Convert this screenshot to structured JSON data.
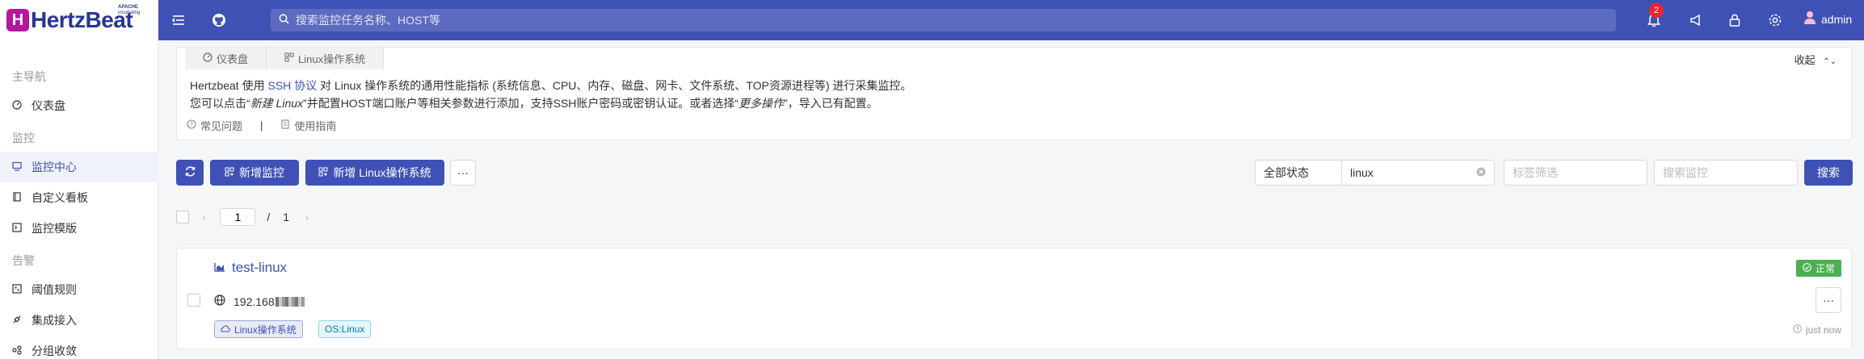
{
  "header": {
    "logo_text": "HertzBeat",
    "logo_sub1": "APACHE",
    "logo_sub2": "incubating",
    "search_placeholder": "搜索监控任务名称、HOST等",
    "notifications_count": "2",
    "user_name": "admin"
  },
  "sidebar": {
    "groups": [
      {
        "label": "主导航"
      },
      {
        "label": "监控"
      },
      {
        "label": "告警"
      }
    ],
    "items": [
      {
        "label": "仪表盘",
        "icon": "dashboard-icon"
      },
      {
        "label": "监控中心",
        "icon": "monitor-icon",
        "active": true
      },
      {
        "label": "自定义看板",
        "icon": "book-icon"
      },
      {
        "label": "监控模版",
        "icon": "code-icon"
      },
      {
        "label": "阈值规则",
        "icon": "rule-icon"
      },
      {
        "label": "集成接入",
        "icon": "api-icon"
      },
      {
        "label": "分组收敛",
        "icon": "group-icon"
      }
    ]
  },
  "panel": {
    "tabs": [
      {
        "label": "仪表盘"
      },
      {
        "label": "Linux操作系统"
      }
    ],
    "collapse_label": "收起",
    "desc_line1_a": "Hertzbeat 使用 ",
    "desc_line1_link": "SSH 协议",
    "desc_line1_b": " 对 Linux 操作系统的通用性能指标 (系统信息、CPU、内存、磁盘、网卡、文件系统、TOP资源进程等) 进行采集监控。",
    "desc_line2_a": "您可以点击“",
    "desc_line2_em1": "新建 Linux",
    "desc_line2_b": "”并配置HOST端口账户等相关参数进行添加，支持SSH账户密码或密钥认证。或者选择“",
    "desc_line2_em2": "更多操作",
    "desc_line2_c": "”，导入已有配置。",
    "faq_label": "常见问题",
    "separator": "|",
    "guide_label": "使用指南"
  },
  "toolbar": {
    "add_monitor": "新增监控",
    "add_linux": "新增 Linux操作系统",
    "more": "···",
    "status_select": "全部状态",
    "search_value": "linux",
    "tag_placeholder": "标签筛选",
    "monitor_placeholder": "搜索监控",
    "search_button": "搜索"
  },
  "pager": {
    "current": "1",
    "divider": "/",
    "total": "1"
  },
  "monitors": [
    {
      "name": "test-linux",
      "status": "正常",
      "host": "192.168",
      "tags": [
        "Linux操作系统",
        "OS:Linux"
      ],
      "time": "just now",
      "more": "···"
    }
  ],
  "colors": {
    "header_bg": "#3f51b5",
    "accent": "#3f51b5",
    "status_ok": "#4caf50",
    "badge": "#f5222d"
  }
}
